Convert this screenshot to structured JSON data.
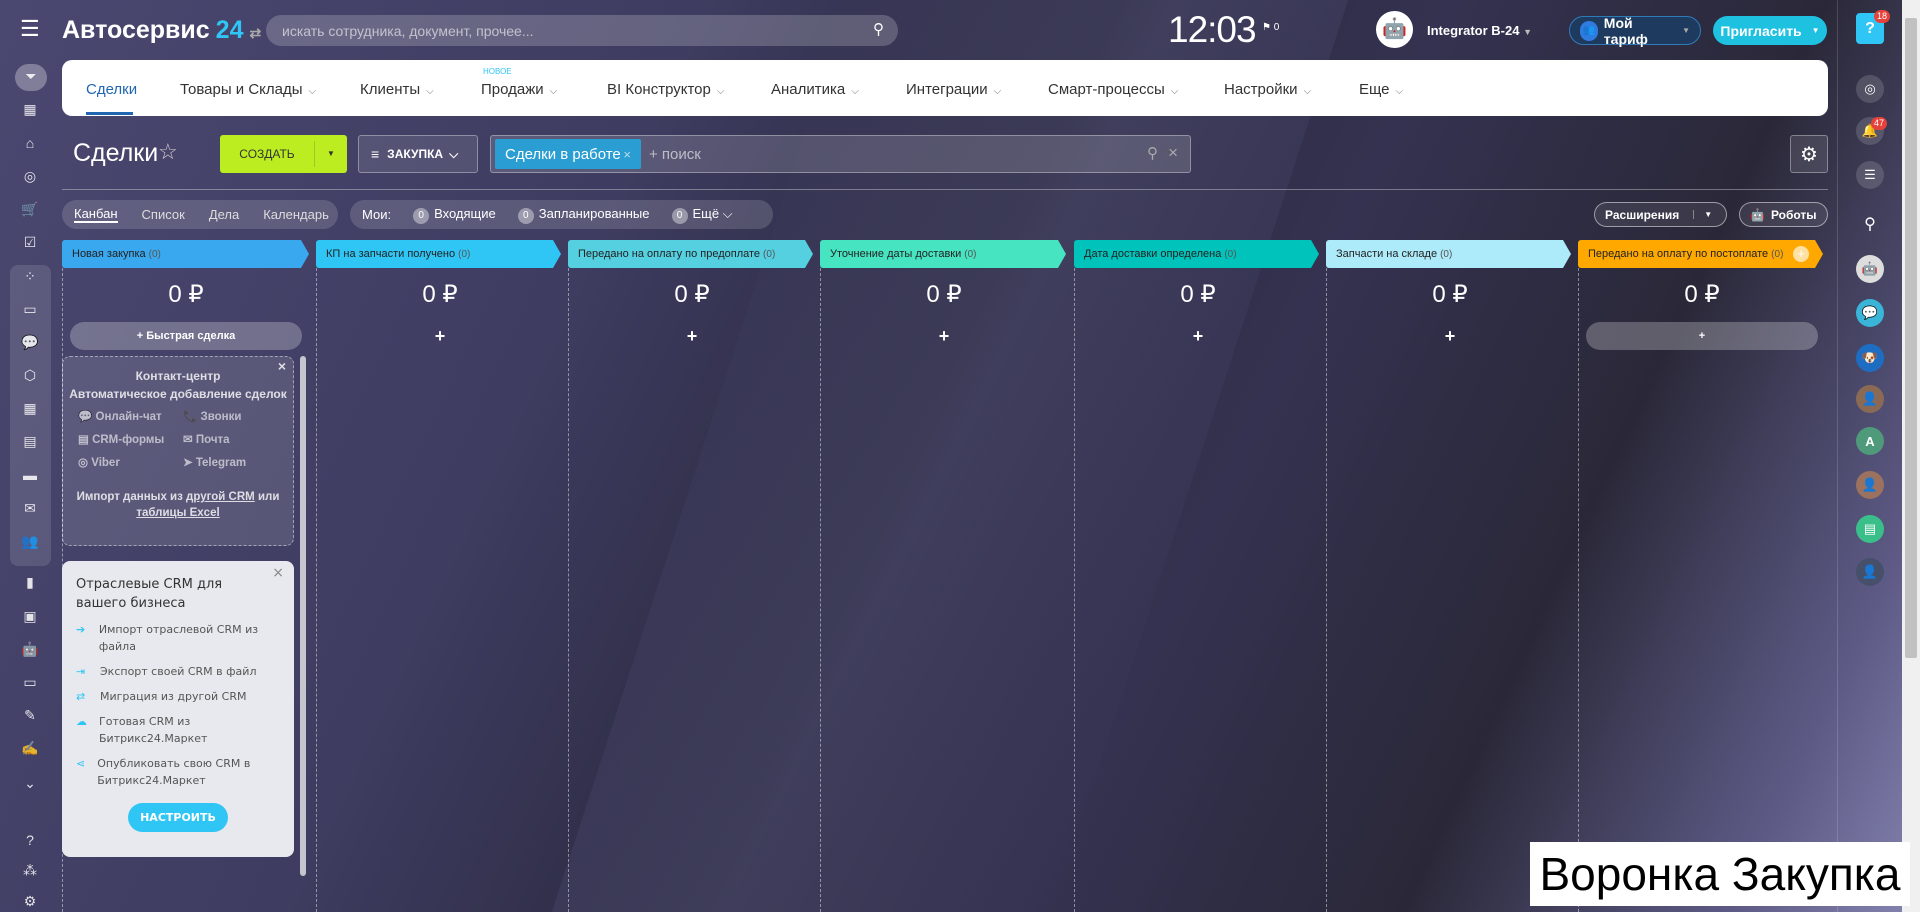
{
  "header": {
    "logo_name": "Автосервис",
    "logo_num": "24",
    "search_placeholder": "искать сотрудника, документ, прочее...",
    "clock": "12:03",
    "flag_count": "0",
    "user_name": "Integrator B-24",
    "tariff_label": "Мой тариф",
    "invite_label": "Пригласить",
    "help_badge": "18"
  },
  "nav": {
    "new_tag": "НОВОЕ",
    "items": [
      {
        "label": "Сделки"
      },
      {
        "label": "Товары и Склады"
      },
      {
        "label": "Клиенты"
      },
      {
        "label": "Продажи"
      },
      {
        "label": "BI Конструктор"
      },
      {
        "label": "Аналитика"
      },
      {
        "label": "Интеграции"
      },
      {
        "label": "Смарт-процессы"
      },
      {
        "label": "Настройки"
      },
      {
        "label": "Еще"
      }
    ]
  },
  "toolbar": {
    "title": "Сделки",
    "create_label": "СОЗДАТЬ",
    "funnel_label": "ЗАКУПКА",
    "filter_chip": "Сделки в работе",
    "search_placeholder": "+ поиск"
  },
  "views": {
    "tabs": [
      "Канбан",
      "Список",
      "Дела",
      "Календарь"
    ],
    "my_label": "Мои:",
    "counters": [
      {
        "count": "0",
        "label": "Входящие"
      },
      {
        "count": "0",
        "label": "Запланированные"
      },
      {
        "count": "0",
        "label": "Ещё"
      }
    ],
    "extensions_label": "Расширения",
    "robots_label": "Роботы"
  },
  "kanban": {
    "columns": [
      {
        "title": "Новая закупка",
        "count": "(0)",
        "sum": "0 ₽",
        "color": "#3aa8ee"
      },
      {
        "title": "КП на запчасти получено",
        "count": "(0)",
        "sum": "0 ₽",
        "color": "#2fc6f6"
      },
      {
        "title": "Передано на оплату по предоплате",
        "count": "(0)",
        "sum": "0 ₽",
        "color": "#55d0e0"
      },
      {
        "title": "Уточнение даты доставки",
        "count": "(0)",
        "sum": "0 ₽",
        "color": "#47e4c2"
      },
      {
        "title": "Дата доставки определена",
        "count": "(0)",
        "sum": "0 ₽",
        "color": "#00c4bb"
      },
      {
        "title": "Запчасти на складе",
        "count": "(0)",
        "sum": "0 ₽",
        "color": "#aeebfa"
      },
      {
        "title": "Передано на оплату по постоплате",
        "count": "(0)",
        "sum": "0 ₽",
        "color": "#ffa900"
      }
    ],
    "quick_deal": "Быстрая сделка",
    "plus": "+"
  },
  "contact_center": {
    "title": "Контакт-центр",
    "subtitle": "Автоматическое добавление сделок",
    "channels": [
      "Онлайн-чат",
      "Звонки",
      "CRM-формы",
      "Почта",
      "Viber",
      "Telegram"
    ],
    "import_text": "Импорт данных из",
    "import_link1": "другой CRM",
    "import_or": "или",
    "import_link2": "таблицы Excel"
  },
  "industry_crm": {
    "title": "Отраслевые CRM для вашего бизнеса",
    "items": [
      "Импорт отраслевой CRM из файла",
      "Экспорт своей CRM в файл",
      "Миграция из другой CRM",
      "Готовая CRM из Битрикс24.Маркет",
      "Опубликовать свою CRM в Битрикс24.Маркет"
    ],
    "button": "НАСТРОИТЬ"
  },
  "right_sidebar": {
    "notifications_badge": "47",
    "avatar_letter": "A"
  },
  "caption": "Воронка Закупка"
}
